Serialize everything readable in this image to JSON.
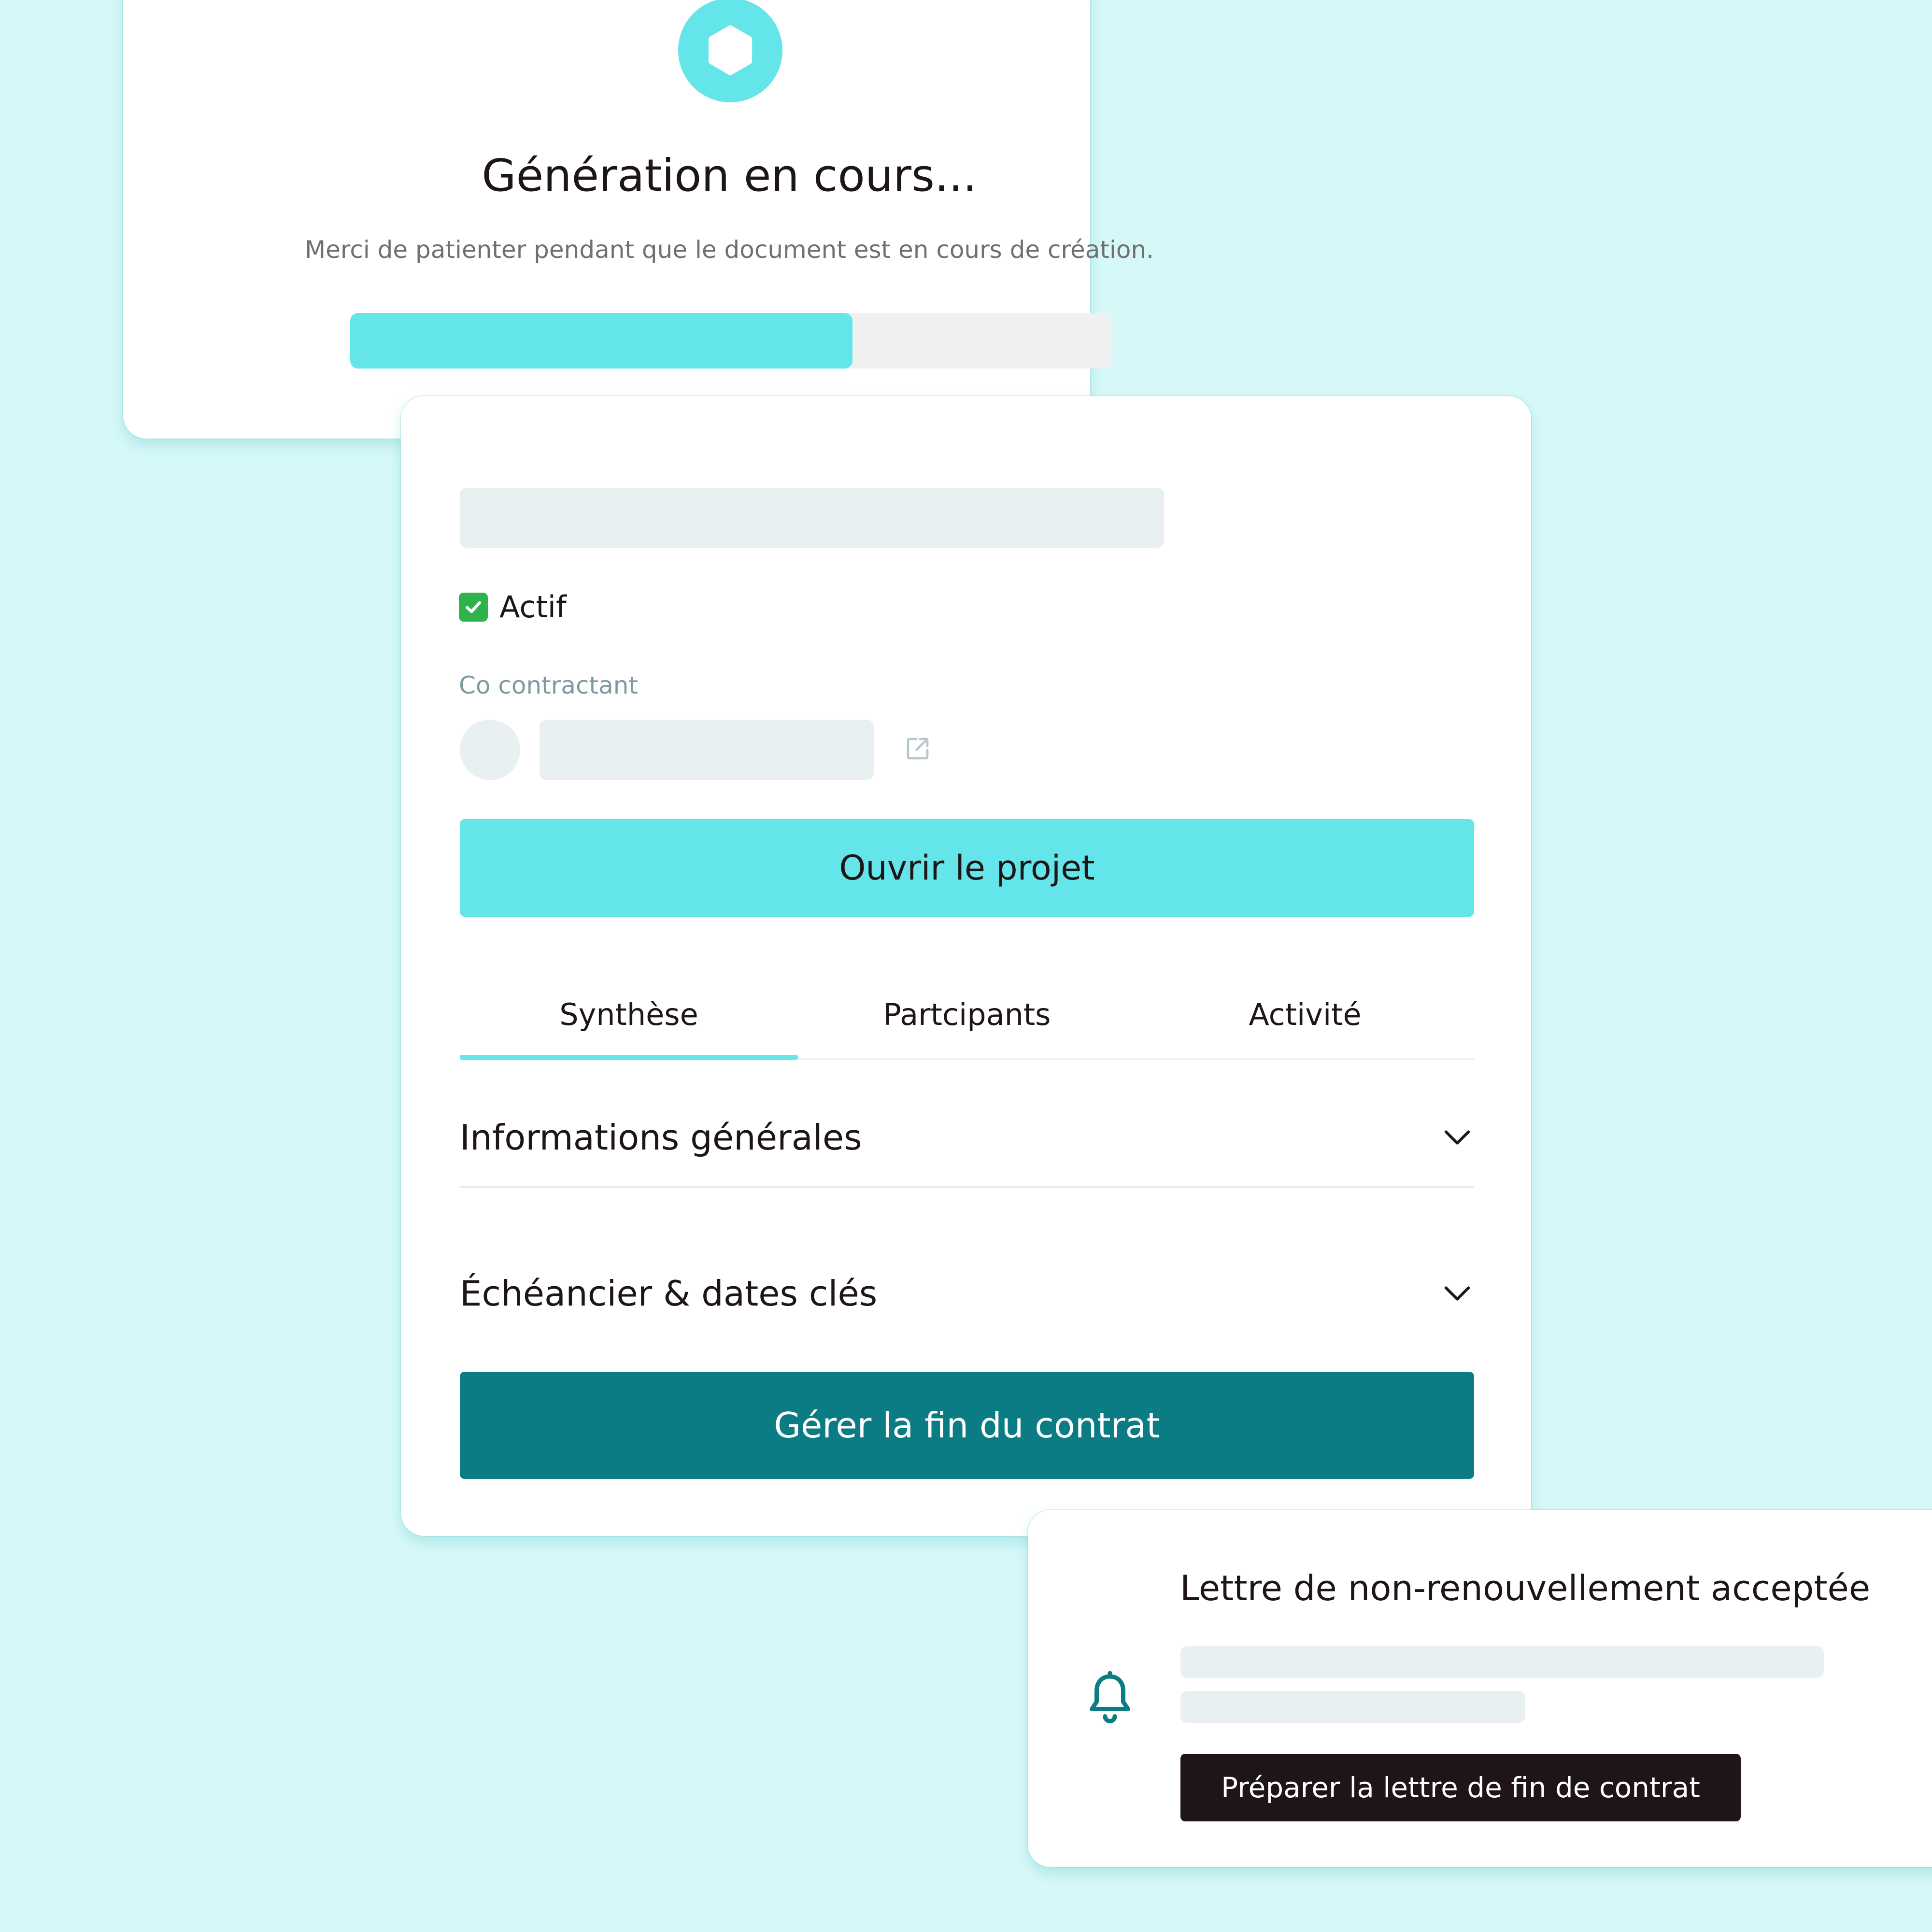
{
  "generation": {
    "title": "Génération en cours...",
    "message": "Merci de patienter pendant que le document est en cours de création.",
    "progress_percent": 66,
    "icon": "hexagon-icon"
  },
  "project": {
    "status_label": "Actif",
    "status_icon": "check-mark-button-icon",
    "cocontractant_label": "Co contractant",
    "open_button_label": "Ouvrir le projet",
    "tabs": [
      {
        "label": "Synthèse",
        "active": true
      },
      {
        "label": "Partcipants",
        "active": false
      },
      {
        "label": "Activité",
        "active": false
      }
    ],
    "accordions": [
      {
        "label": "Informations générales"
      },
      {
        "label": "Échéancier & dates clés"
      }
    ],
    "end_contract_button_label": "Gérer la fin du contrat"
  },
  "notification": {
    "title": "Lettre de non-renouvellement acceptée",
    "button_label": "Préparer la lettre de fin de contrat",
    "icon": "bell-icon"
  },
  "colors": {
    "background": "#d6f8f8",
    "accent": "#64e5ea",
    "primary_dark": "#0c7c84",
    "button_dark": "#1f1516",
    "success": "#2eb34a"
  }
}
